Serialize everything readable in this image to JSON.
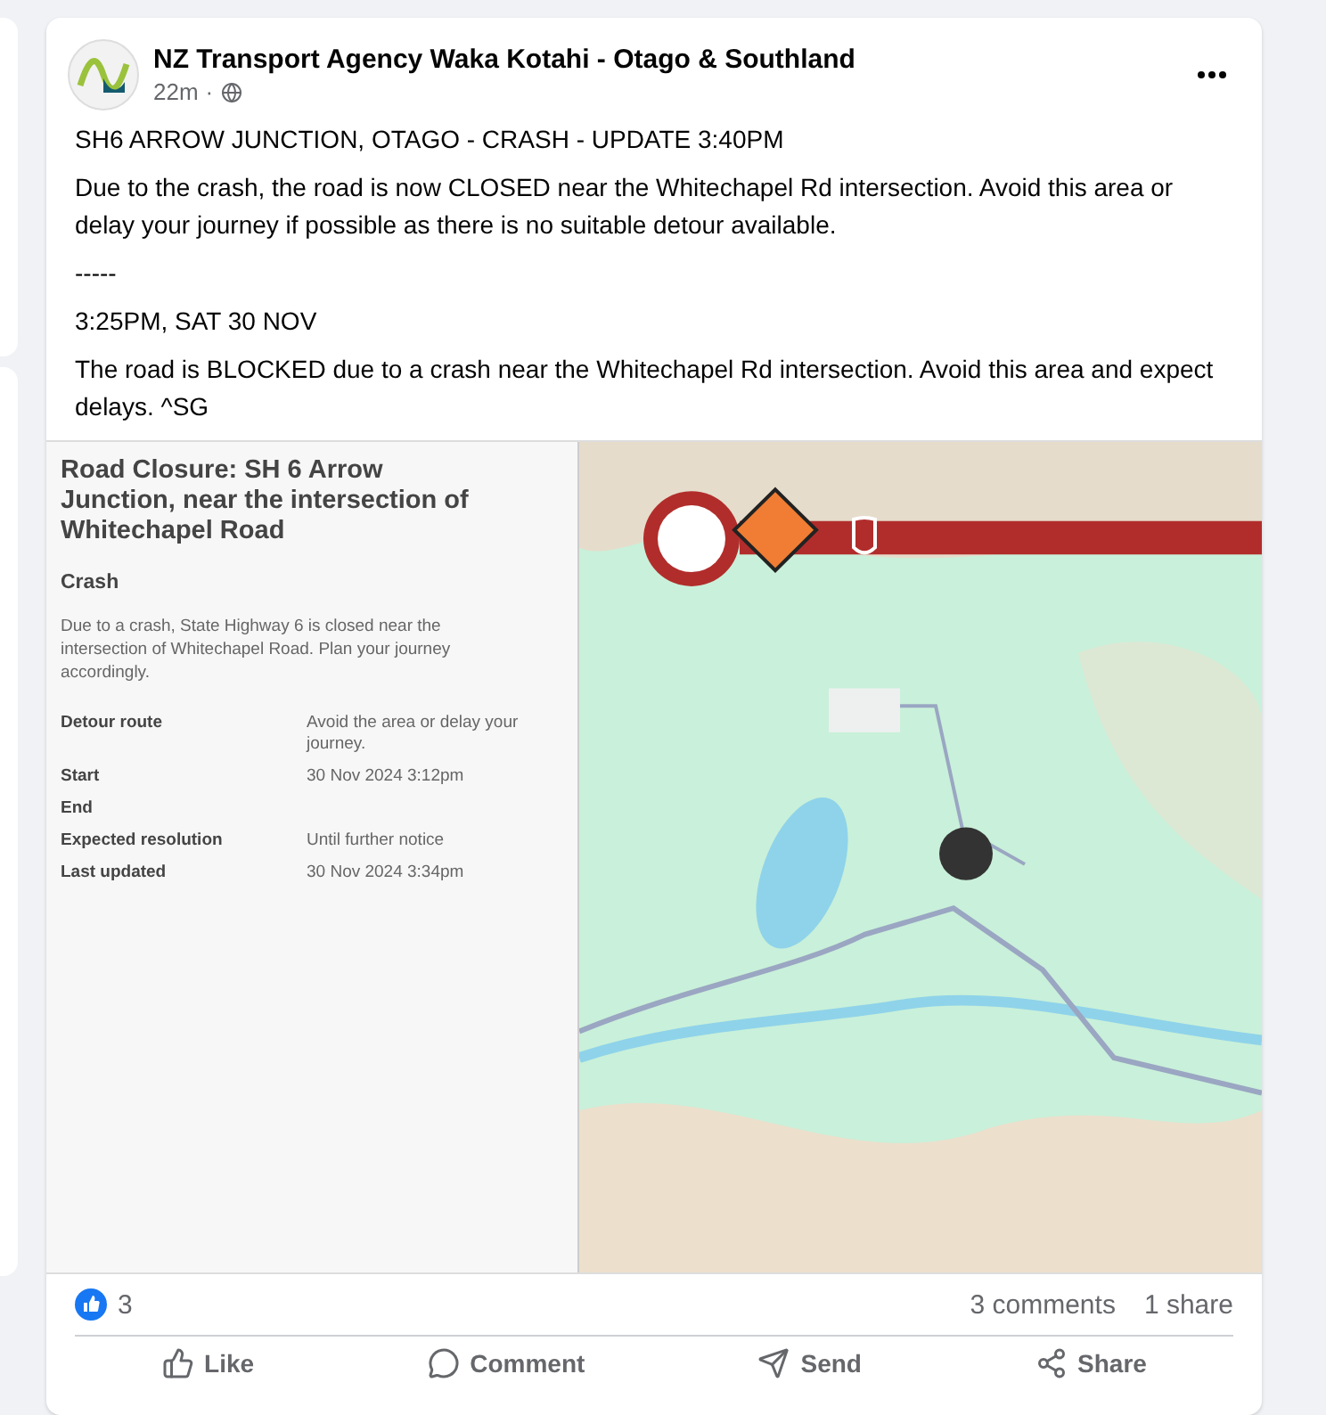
{
  "post": {
    "author": "NZ Transport Agency Waka Kotahi - Otago & Southland",
    "time": "22m",
    "separator": "·",
    "paragraphs": [
      "SH6 ARROW JUNCTION, OTAGO - CRASH - UPDATE 3:40PM",
      "Due to the crash, the road is now CLOSED near the Whitechapel Rd intersection. Avoid this area or delay your journey if possible as there is no suitable detour available.",
      "-----",
      "3:25PM, SAT 30 NOV",
      "The road is BLOCKED due to a crash near the Whitechapel Rd intersection. Avoid this area and expect delays. ^SG"
    ]
  },
  "closure": {
    "title": "Road Closure: SH 6 Arrow Junction, near the intersection of Whitechapel Road",
    "type": "Crash",
    "description": "Due to a crash, State Highway 6 is closed near the intersection of Whitechapel Road. Plan your journey accordingly.",
    "details": [
      {
        "label": "Detour route",
        "value": "Avoid the area or delay your journey."
      },
      {
        "label": "Start",
        "value": "30 Nov 2024 3:12pm"
      },
      {
        "label": "End"
      },
      {
        "label": "Expected resolution",
        "value": "Until further notice"
      },
      {
        "label": "Last updated",
        "value": "30 Nov 2024 3:34pm"
      }
    ]
  },
  "reactions": {
    "count": "3",
    "comments": "3 comments",
    "shares": "1 share"
  },
  "actions": [
    {
      "label": "Like",
      "kind": "like"
    },
    {
      "label": "Comment",
      "kind": "comment"
    },
    {
      "label": "Send",
      "kind": "send"
    },
    {
      "label": "Share",
      "kind": "share"
    }
  ]
}
